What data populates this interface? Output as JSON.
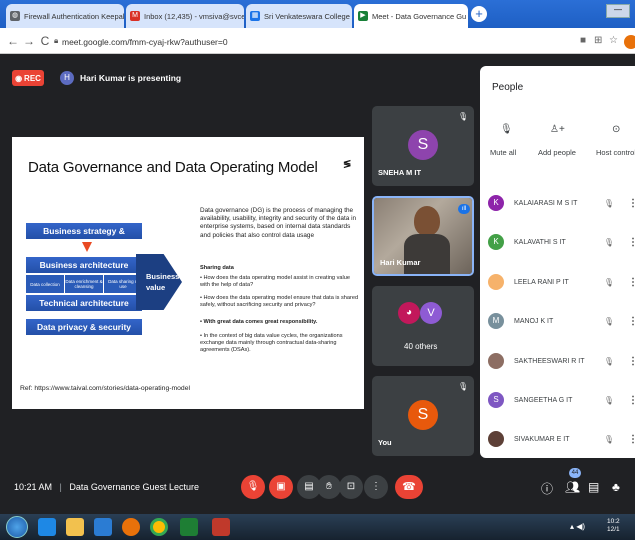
{
  "browser": {
    "tabs": [
      {
        "label": "Firewall Authentication Keepalive",
        "favicon_color": "#5f6368",
        "active": false
      },
      {
        "label": "Inbox (12,435) - vmsiva@svce.ac",
        "favicon_color": "#d93025",
        "active": false
      },
      {
        "label": "Sri Venkateswara College of Engi",
        "favicon_color": "#1a73e8",
        "active": false
      },
      {
        "label": "Meet - Data Governance Gu",
        "favicon_color": "#188038",
        "active": true
      }
    ],
    "url": "meet.google.com/fmm-cyaj-rkw?authuser=0"
  },
  "meet": {
    "rec_label": "REC",
    "presenter_initial": "H",
    "presenter_text": "Hari Kumar is presenting",
    "slide": {
      "title": "Data Governance and Data Operating Model",
      "boxes": {
        "strategy": "Business strategy & objectives",
        "arch": "Business architecture",
        "tech": "Technical architecture",
        "privacy": "Data privacy & security",
        "value": "Business value",
        "collect": "Data collection",
        "enrich": "Data enrichment & cleansing",
        "share": "Data sharing & use"
      },
      "intro": "Data governance (DG) is the process of managing the availability, usability, integrity and security of the data in enterprise systems, based on internal data standards and policies that also control data usage",
      "sharing_heading": "Sharing data",
      "bullets": [
        "• How does the data operating model assist in creating value with the help of data?",
        "• How does the data operating model ensure that data is shared safely, without sacrificing security and privacy?",
        "• With great data comes great responsibility.",
        "• In the context of big data value cycles, the organizations exchange data mainly through contractual data-sharing agreements (DSAs)."
      ],
      "reference": "Ref: https://www.taival.com/stories/data-operating-model"
    },
    "tiles": {
      "sneha": {
        "initial": "S",
        "name": "SNEHA M IT",
        "color": "#8e44ad"
      },
      "hari": {
        "name": "Hari Kumar"
      },
      "others": {
        "initial": "V",
        "label": "40 others",
        "color": "#8e5bd4"
      },
      "you": {
        "initial": "S",
        "name": "You",
        "color": "#e8590c"
      }
    },
    "people_panel": {
      "title": "People",
      "mute_all": "Mute all",
      "add_people": "Add people",
      "host_controls": "Host controls",
      "participants": [
        {
          "initial": "K",
          "name": "KALAIARASI M S IT",
          "color": "#8e24aa"
        },
        {
          "initial": "K",
          "name": "KALAVATHI S IT",
          "color": "#43a047"
        },
        {
          "initial": "",
          "name": "LEELA RANI P IT",
          "color": "#f6b26b"
        },
        {
          "initial": "M",
          "name": "MANOJ K IT",
          "color": "#78909c"
        },
        {
          "initial": "",
          "name": "SAKTHEESWARI R IT",
          "color": "#8d6e63"
        },
        {
          "initial": "S",
          "name": "SANGEETHA G IT",
          "color": "#7e57c2"
        },
        {
          "initial": "",
          "name": "SIVAKUMAR E IT",
          "color": "#5d4037"
        }
      ]
    },
    "bottom": {
      "time": "10:21 AM",
      "title": "Data Governance Guest Lecture",
      "people_count": "44"
    }
  },
  "taskbar": {
    "clock_time": "10:2",
    "clock_date": "12/1"
  }
}
